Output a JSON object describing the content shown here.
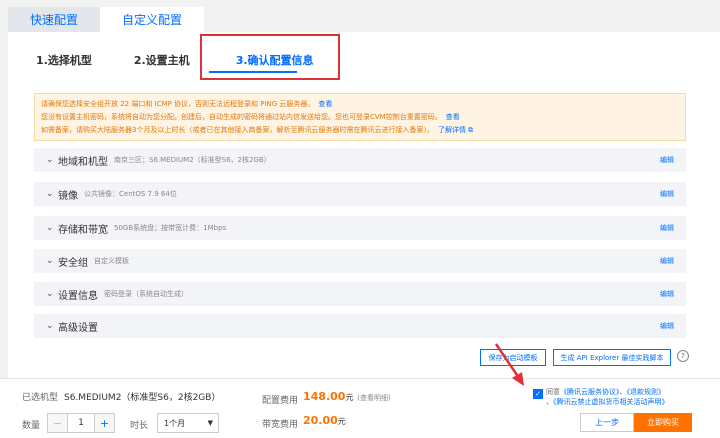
{
  "tabs": [
    {
      "label": "快速配置"
    },
    {
      "label": "自定义配置"
    }
  ],
  "steps": [
    {
      "label": "1.选择机型"
    },
    {
      "label": "2.设置主机"
    },
    {
      "label": "3.确认配置信息"
    }
  ],
  "notice": {
    "line1": "请确保您选择安全组开放 22 端口和 ICMP 协议，否则无法远程登录和 PING 云服务器。",
    "line1_link": "查看",
    "line2": "您没有设置主机密码，系统将自动为您分配。创建后，自动生成的密码将通过站内信发送给您。您也可登录CVM控制台重置密码。",
    "line2_link": "查看",
    "line3": "如需备案，请购买大陆服务器3个月及以上时长（或者已在其他接入商备案，解析至腾讯云服务器时需在腾讯云进行接入备案）。",
    "line3_link": "了解详情"
  },
  "sections": [
    {
      "title": "地域和机型",
      "desc": "南京三区；S6.MEDIUM2（标准型S6，2核2GB）",
      "edit": "编辑"
    },
    {
      "title": "镜像",
      "desc": "公共镜像：CentOS 7.9 64位",
      "edit": "编辑"
    },
    {
      "title": "存储和带宽",
      "desc": "50GB系统盘；按带宽计费：1Mbps",
      "edit": "编辑"
    },
    {
      "title": "安全组",
      "desc": "自定义模板",
      "edit": "编辑"
    },
    {
      "title": "设置信息",
      "desc": "密码登录（系统自动生成）",
      "edit": "编辑"
    },
    {
      "title": "高级设置",
      "desc": "",
      "edit": "编辑"
    }
  ],
  "actions": {
    "save_template": "保存为启动模板",
    "gen_script": "生成 API Explorer 最佳实践脚本",
    "help": "?"
  },
  "bottom": {
    "selected_label": "已选机型",
    "selected_value": "S6.MEDIUM2（标准型S6，2核2GB）",
    "qty_label": "数量",
    "qty_value": "1",
    "duration_label": "时长",
    "duration_value": "1个月",
    "config_fee_label": "配置费用",
    "config_fee": "148.00",
    "config_fee_unit": "元",
    "config_fee_note": "(查看明细)",
    "bandwidth_fee_label": "带宽费用",
    "bandwidth_fee": "20.00",
    "bandwidth_fee_unit": "元",
    "agree_prefix": "同意",
    "agree_link1": "《腾讯云服务协议》",
    "agree_link2": "《退款规则》",
    "agree_link3": "《腾讯云禁止虚拟货币相关活动声明》",
    "prev_button": "上一步",
    "buy_button": "立即购买"
  },
  "colors": {
    "accent": "#006eff",
    "orange": "#ff7200",
    "highlight": "#e0323a"
  }
}
